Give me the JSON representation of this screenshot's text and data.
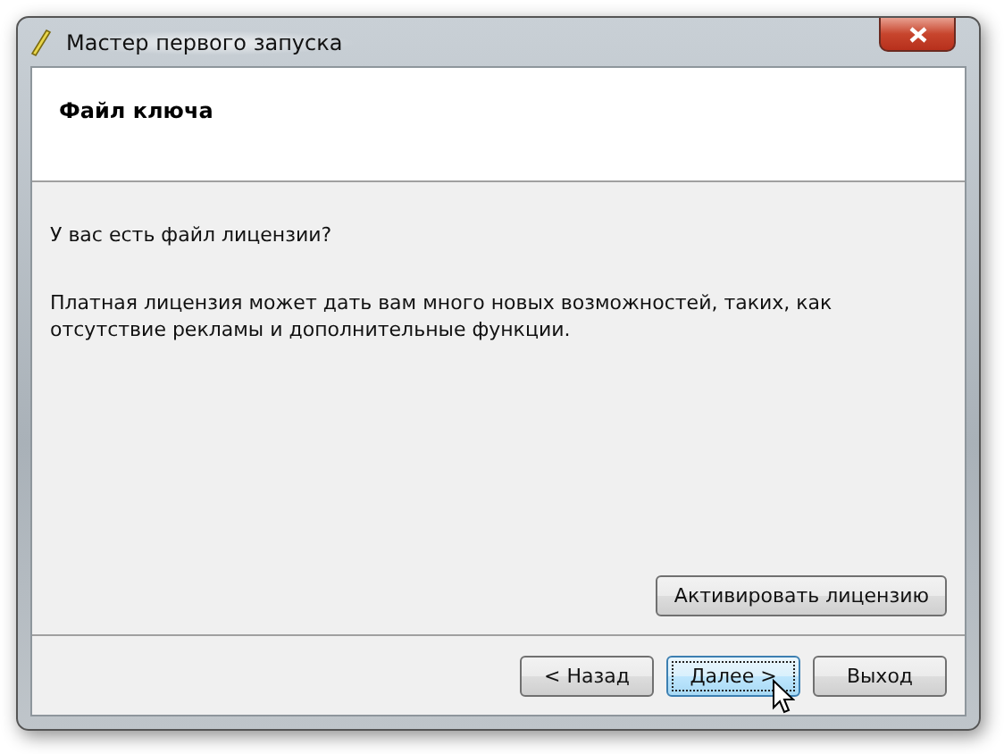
{
  "window": {
    "title": "Мастер первого запуска"
  },
  "header": {
    "title": "Файл ключа"
  },
  "question": "У вас есть файл лицензии?",
  "description": "Платная лицензия может дать вам много новых возможностей, таких, как отсутствие рекламы и дополнительные функции.",
  "activate_button": "Активировать лицензию",
  "buttons": [
    {
      "label": "< Назад",
      "highlighted": false
    },
    {
      "label": "Далее >",
      "highlighted": true
    },
    {
      "label": "Выход",
      "highlighted": false
    }
  ]
}
